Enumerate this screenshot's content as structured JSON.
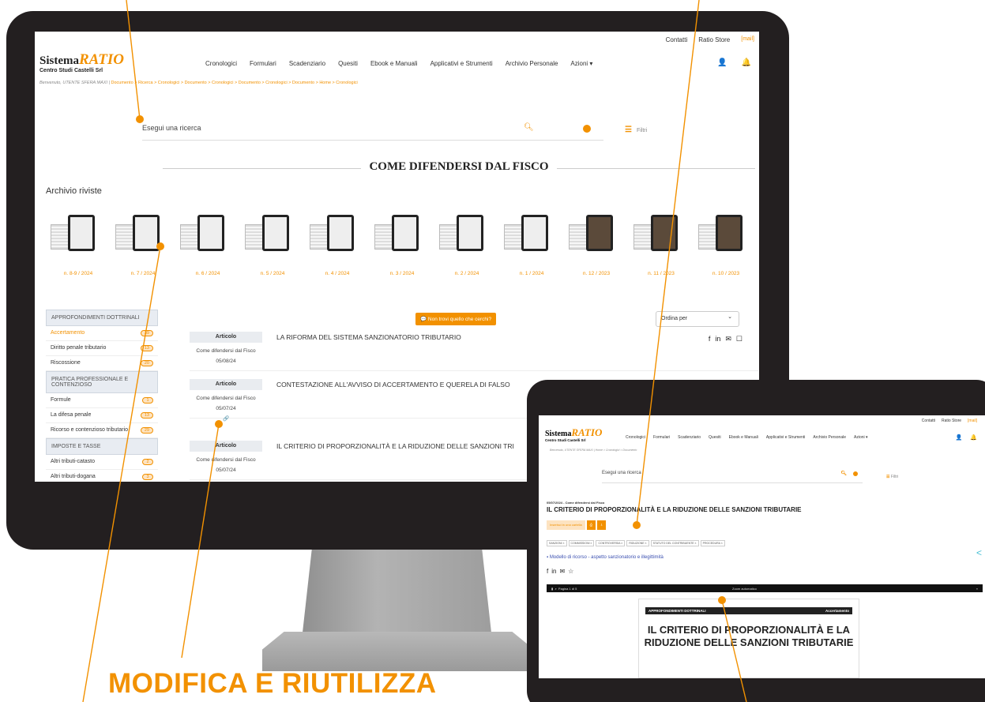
{
  "monitor": {
    "topbar": {
      "links": [
        "Contatti",
        "Ratio Store"
      ],
      "mail": "[mail]"
    },
    "logo": {
      "sistema": "Sistema",
      "ratio": "RATIO",
      "company": "Centro Studi Castelli Srl"
    },
    "nav": [
      "Cronologici",
      "Formulari",
      "Scadenziario",
      "Quesiti",
      "Ebook e Manuali",
      "Applicativi e Strumenti",
      "Archivio Personale",
      "Azioni ▾"
    ],
    "breadcrumb": {
      "welcome": "Benvenuto, UTENTE SFERA MAXI",
      "trail": "Documento > Ricerca > Cronologici > Documento > Cronologici > Documento > Cronologici > Documento > Home > Cronologici"
    },
    "search": {
      "placeholder": "Esegui una ricerca",
      "filters": "Filtri"
    },
    "header": "COME DIFENDERSI DAL FISCO",
    "archive_title": "Archivio riviste",
    "issues": [
      "n. 8-9 / 2024",
      "n. 7 / 2024",
      "n. 6 / 2024",
      "n. 5 / 2024",
      "n. 4 / 2024",
      "n. 3 / 2024",
      "n. 2 / 2024",
      "n. 1 / 2024",
      "n. 12 / 2023",
      "n. 11 / 2023",
      "n. 10 / 2023"
    ],
    "sidebar": {
      "g1": "APPROFONDIMENTI DOTTRINALI",
      "g1_items": [
        {
          "label": "Accertamento",
          "n": "39"
        },
        {
          "label": "Diritto penale tributario",
          "n": "13"
        },
        {
          "label": "Riscossione",
          "n": "20"
        }
      ],
      "g2": "PRATICA PROFESSIONALE E CONTENZIOSO",
      "g2_items": [
        {
          "label": "Formule",
          "n": "1"
        },
        {
          "label": "La difesa penale",
          "n": "13"
        },
        {
          "label": "Ricorso e contenzioso tributario",
          "n": "29"
        }
      ],
      "g3": "IMPOSTE E TASSE",
      "g3_items": [
        {
          "label": "Altri tributi-catasto",
          "n": "2"
        },
        {
          "label": "Altri tributi-dogana",
          "n": "3"
        }
      ]
    },
    "not_found": "💬 Non trovi quello che cerchi?",
    "sort": "Ordina per",
    "articles": [
      {
        "tag": "Articolo",
        "source": "Come difendersi dal Fisco",
        "date": "05/08/24",
        "title": "LA RIFORMA DEL SISTEMA SANZIONATORIO TRIBUTARIO"
      },
      {
        "tag": "Articolo",
        "source": "Come difendersi dal Fisco",
        "date": "05/07/24",
        "title": "CONTESTAZIONE ALL'AVVISO DI ACCERTAMENTO E QUERELA DI FALSO"
      },
      {
        "tag": "Articolo",
        "source": "Come difendersi dal Fisco",
        "date": "05/07/24",
        "title": "IL CRITERIO DI PROPORZIONALITÀ E LA RIDUZIONE DELLE SANZIONI TRI"
      }
    ]
  },
  "tablet": {
    "topbar": [
      "Contatti",
      "Ratio Store",
      "[mail]"
    ],
    "nav": [
      "Cronologici",
      "Formulari",
      "Scadenziario",
      "Quesiti",
      "Ebook e Manuali",
      "Applicativi e Strumenti",
      "Archivio Personale",
      "Azioni ▾"
    ],
    "breadcrumb": "Benvenuto, UTENTE SFERA MAXI | Home > Cronologici > Documento",
    "search": "Esegui una ricerca",
    "filters": "Filtri",
    "meta": "05/07/2024 - Come difendersi dal Fisco",
    "title": "IL CRITERIO DI PROPORZIONALITÀ E LA RIDUZIONE DELLE SANZIONI TRIBUTARIE",
    "btn_folder": "Inserisci in una cartella",
    "tags": [
      "SANZIONI ×",
      "COMMISSIONI ×",
      "CONTROVERSIA ×",
      "RIDUZIONE ×",
      "STATUTO DEL CONTRIBUENTE ×",
      "PROCEDURA ×"
    ],
    "model": "Modello di ricorso - aspetto sanzionatorio e illegittimità",
    "pdf": {
      "page_label": "Pagina",
      "page": "1",
      "of": "di 5",
      "zoom": "Zoom automatico"
    },
    "doc": {
      "section": "APPROFONDIMENTI DOTTRINALI",
      "category": "Accertamento",
      "title": "IL CRITERIO DI PROPORZIONALITÀ E LA RIDUZIONE DELLE SANZIONI TRIBUTARIE"
    }
  },
  "callout": "MODIFICA E RIUTILIZZA",
  "colors": {
    "accent": "#f29100",
    "frame": "#231f20"
  }
}
